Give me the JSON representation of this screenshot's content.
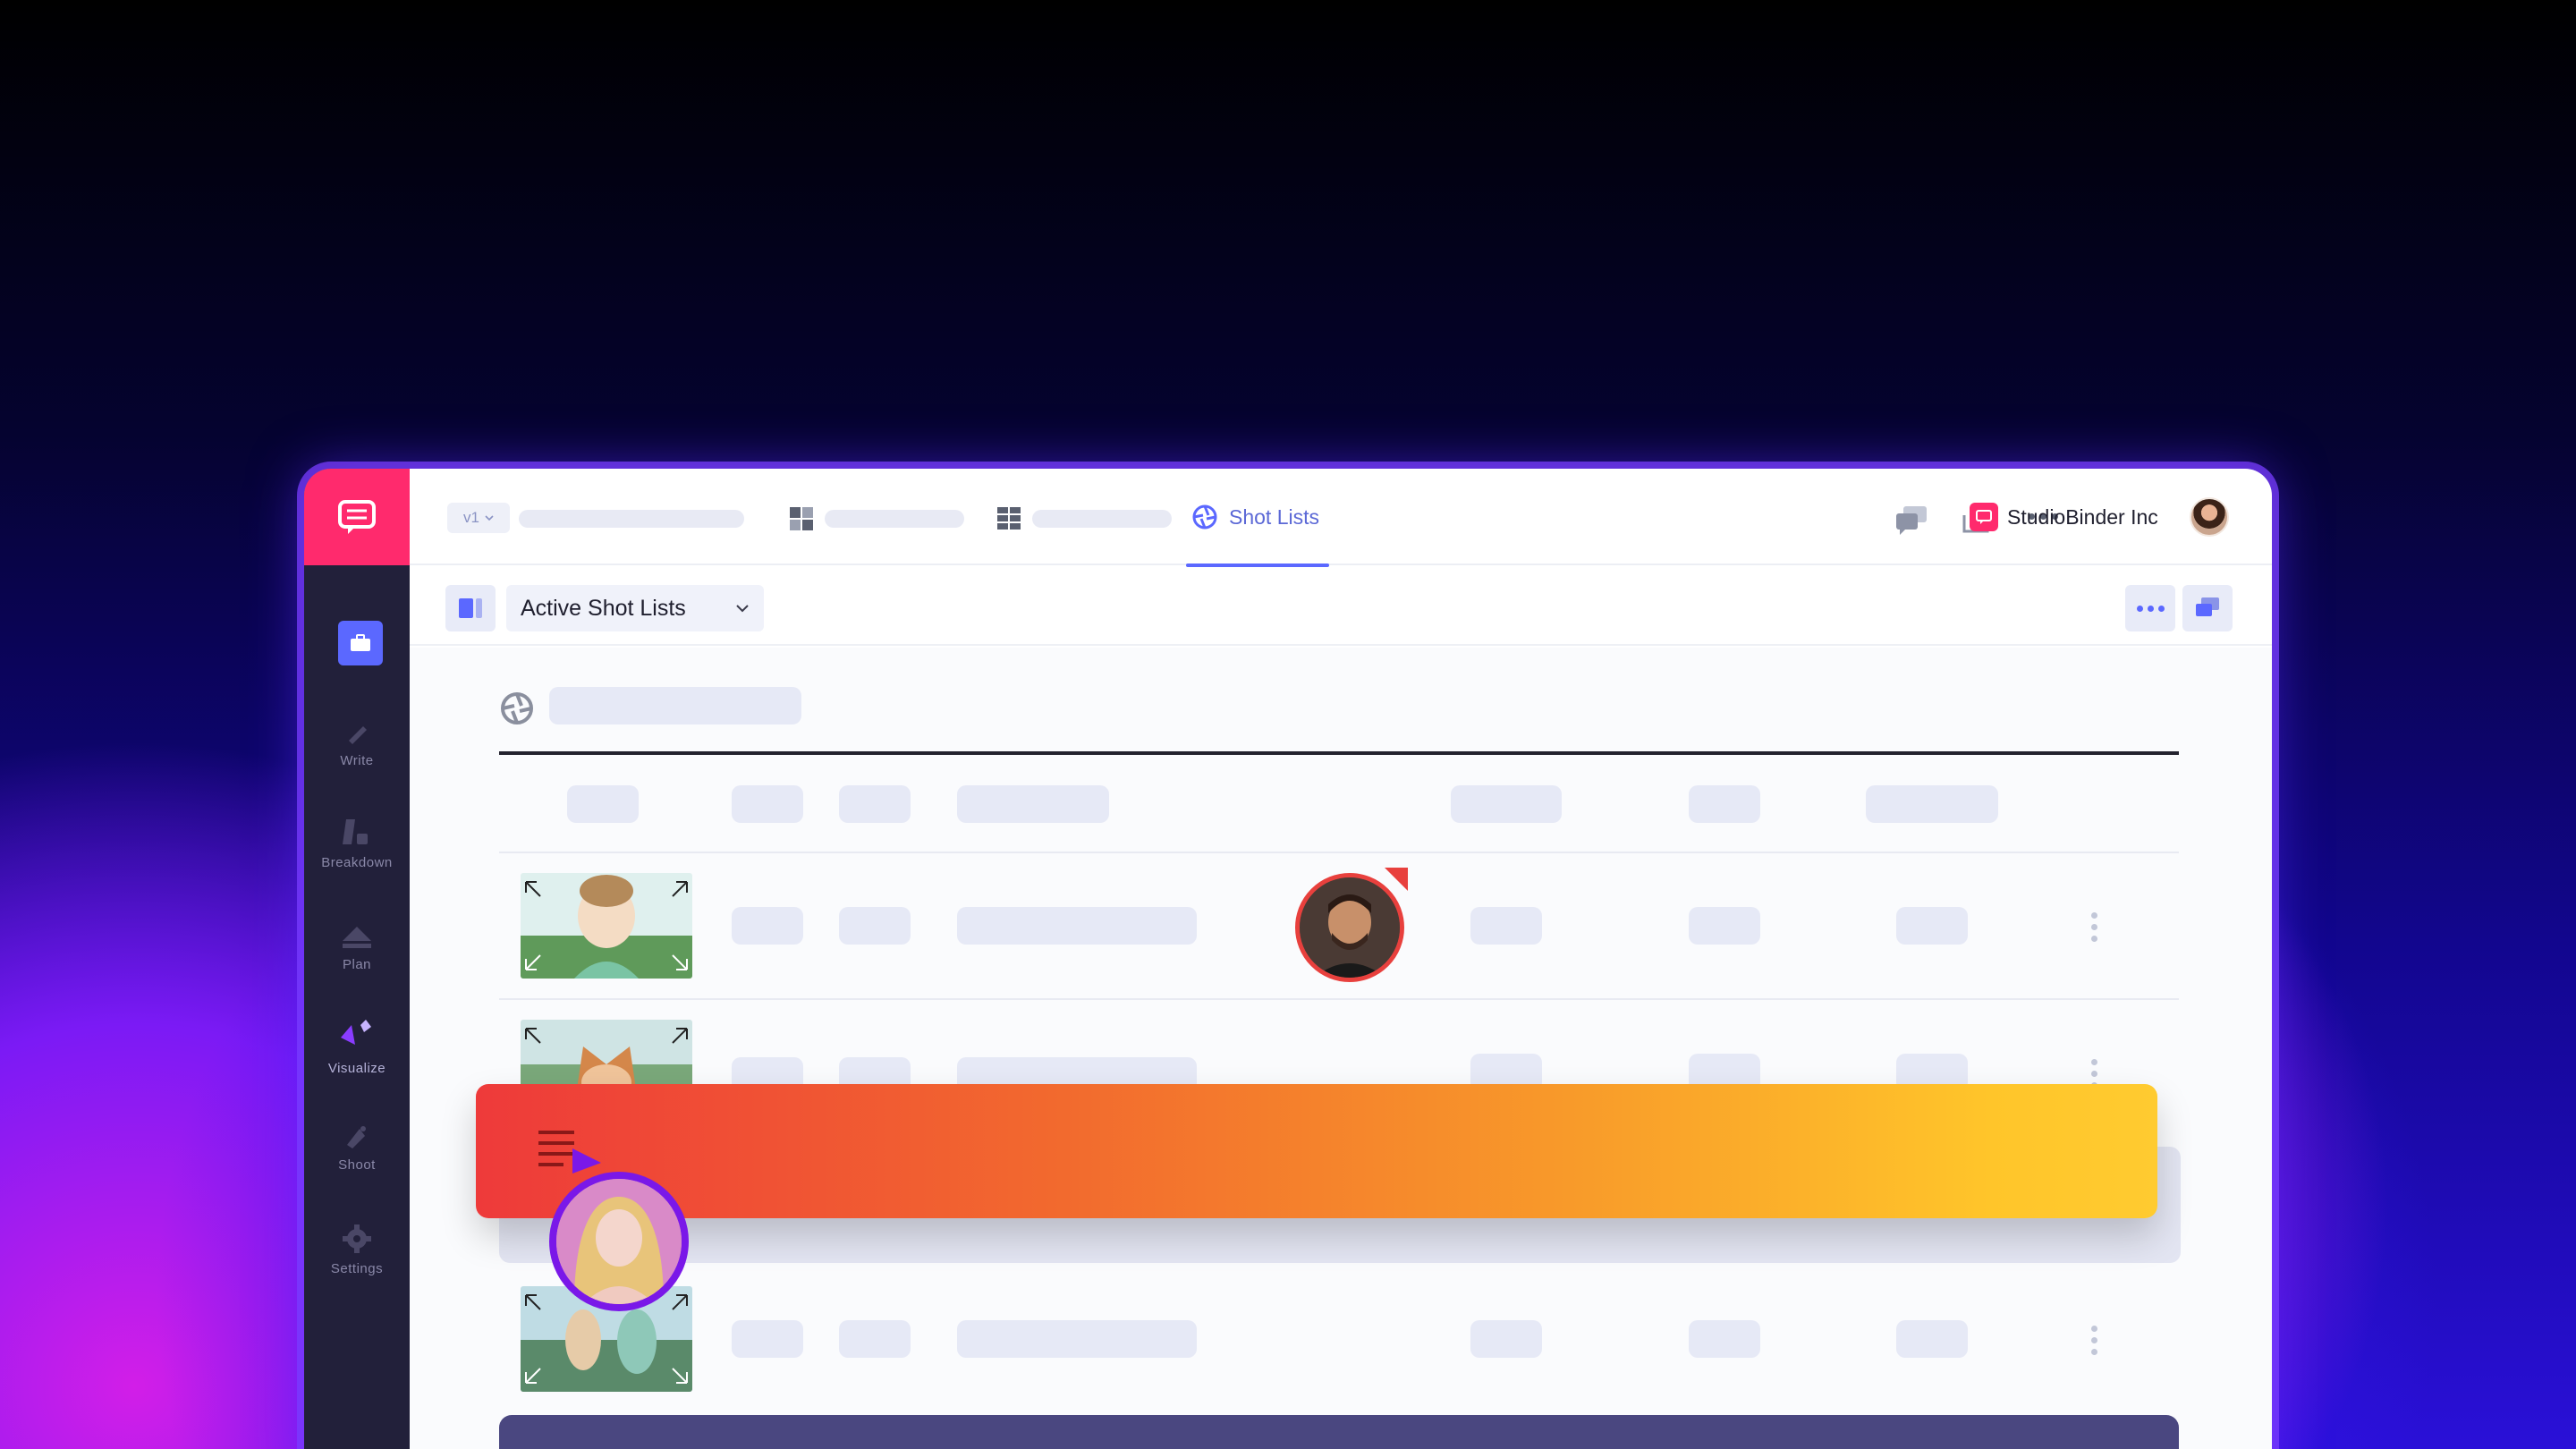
{
  "app": {
    "version_label": "v1",
    "active_tab_label": "Shot Lists",
    "company_name": "StudioBinder Inc"
  },
  "sidebar": {
    "items": [
      {
        "label": "Write",
        "icon": "pencil-icon"
      },
      {
        "label": "Breakdown",
        "icon": "breakdown-icon"
      },
      {
        "label": "Plan",
        "icon": "plan-icon"
      },
      {
        "label": "Visualize",
        "icon": "visualize-icon"
      },
      {
        "label": "Shoot",
        "icon": "shoot-icon"
      },
      {
        "label": "Settings",
        "icon": "gear-icon"
      }
    ]
  },
  "toolbar": {
    "view_select_value": "Active Shot Lists"
  },
  "colors": {
    "brand_pink": "#ff2a6d",
    "accent_blue": "#5b68ff",
    "sidebar_dark": "#22203a",
    "drag_gradient_start": "#ee3a3a",
    "drag_gradient_end": "#ffcb30"
  }
}
